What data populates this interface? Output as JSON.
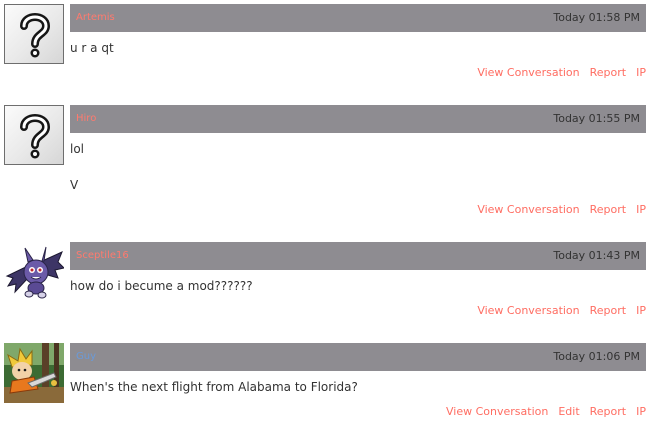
{
  "posts": [
    {
      "username": "Artemis",
      "time": "Today 01:58 PM",
      "message_lines": [
        "u r a qt"
      ],
      "actions": [
        "View Conversation",
        "Report",
        "IP"
      ],
      "avatar_icon": "question-mark-icon"
    },
    {
      "username": "Hiro",
      "time": "Today 01:55 PM",
      "message_lines": [
        "lol",
        "V"
      ],
      "actions": [
        "View Conversation",
        "Report",
        "IP"
      ],
      "avatar_icon": "question-mark-icon"
    },
    {
      "username": "Sceptile16",
      "time": "Today 01:43 PM",
      "message_lines": [
        "how do i becume a mod??????"
      ],
      "actions": [
        "View Conversation",
        "Report",
        "IP"
      ],
      "avatar_icon": "purple-bat-creature-avatar"
    },
    {
      "username": "Guy",
      "time": "Today 01:06 PM",
      "message_lines": [
        "When's the next flight from Alabama to Florida?"
      ],
      "actions": [
        "View Conversation",
        "Edit",
        "Report",
        "IP"
      ],
      "avatar_icon": "forest-character-avatar"
    }
  ],
  "colors": {
    "header_bg": "#8e8c91",
    "link": "#ff6d62",
    "username": "#ff7a6e",
    "username_guy": "#6a9ad8",
    "text": "#333333"
  }
}
